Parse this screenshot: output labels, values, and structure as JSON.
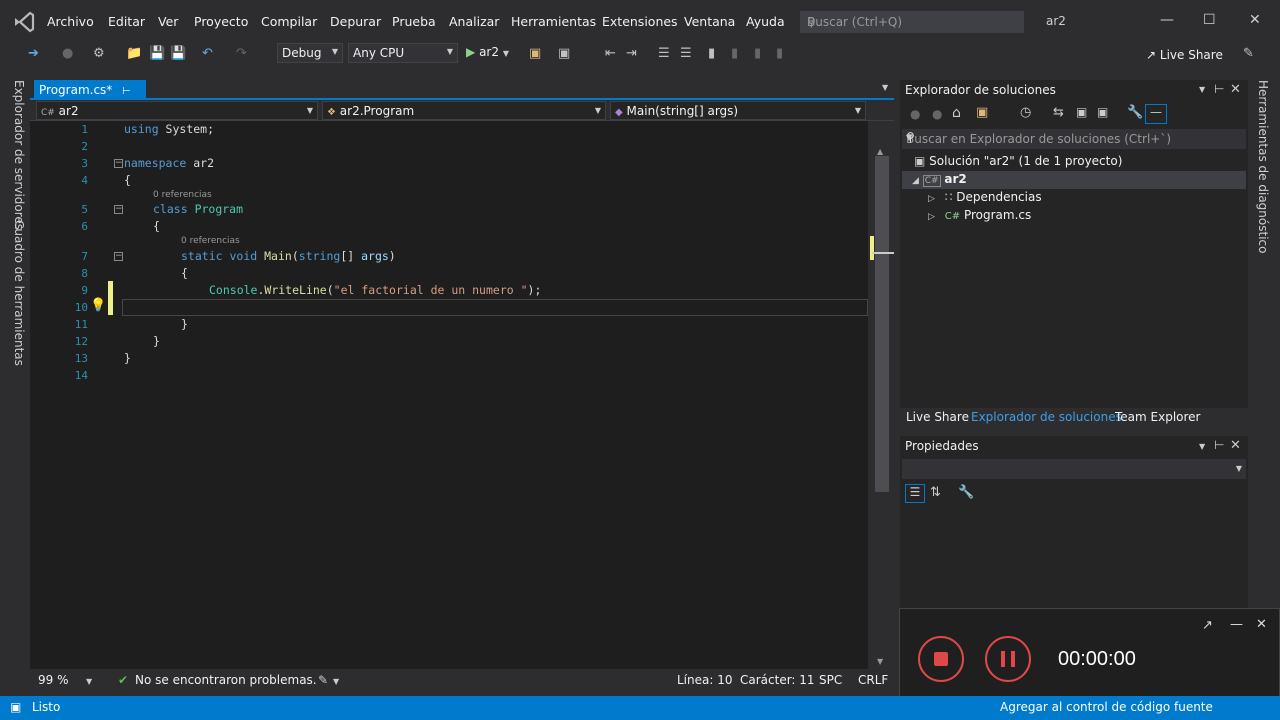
{
  "menu": {
    "items": [
      "Archivo",
      "Editar",
      "Ver",
      "Proyecto",
      "Compilar",
      "Depurar",
      "Prueba",
      "Analizar",
      "Herramientas",
      "Extensiones",
      "Ventana",
      "Ayuda"
    ],
    "search_placeholder": "Buscar (Ctrl+Q)",
    "solution_name": "ar2"
  },
  "toolbar": {
    "config": "Debug",
    "platform": "Any CPU",
    "run_target": "ar2",
    "live_share": "Live Share"
  },
  "left_strip": {
    "server_explorer": "Explorador de servidores",
    "toolbox": "Cuadro de herramientas"
  },
  "right_strip": {
    "diagnostics": "Herramientas de diagnóstico"
  },
  "editor": {
    "tab_label": "Program.cs*",
    "nav_project": "ar2",
    "nav_class": "ar2.Program",
    "nav_member": "Main(string[] args)",
    "line_numbers": [
      "1",
      "2",
      "3",
      "4",
      "5",
      "6",
      "7",
      "8",
      "9",
      "10",
      "11",
      "12",
      "13",
      "14"
    ],
    "refs_label": "0 referencias",
    "code": {
      "l1_kw": "using",
      "l1_rest": " System;",
      "l3_kw": "namespace",
      "l3_rest": " ar2",
      "open_brace": "{",
      "close_brace": "}",
      "l5_kw": "class",
      "l5_type": "Program",
      "l7_kw1": "static",
      "l7_kw2": "void",
      "l7_method": "Main",
      "l7_p1": "(",
      "l7_kw3": "string",
      "l7_p2": "[] ",
      "l7_param": "args",
      "l7_p3": ")",
      "l9_type": "Console",
      "l9_dot": ".",
      "l9_method": "WriteLine",
      "l9_open": "(",
      "l9_str": "\"el factorial de un numero \"",
      "l9_close": ");"
    }
  },
  "editor_status": {
    "zoom": "99 %",
    "problems": "No se encontraron problemas.",
    "line": "Línea: 10",
    "char": "Carácter: 11",
    "indent": "SPC",
    "eol": "CRLF"
  },
  "solution_explorer": {
    "title": "Explorador de soluciones",
    "search_placeholder": "Buscar en Explorador de soluciones (Ctrl+`)",
    "solution": "Solución \"ar2\" (1 de 1 proyecto)",
    "project": "ar2",
    "dependencies": "Dependencias",
    "file": "Program.cs",
    "tabs": [
      "Live Share",
      "Explorador de soluciones",
      "Team Explorer"
    ]
  },
  "properties": {
    "title": "Propiedades"
  },
  "recording": {
    "time": "00:00:00"
  },
  "statusbar": {
    "text": "Listo",
    "right_text": "Agregar al control de código fuente"
  },
  "colors": {
    "accent": "#007acc",
    "record_red": "#e04848"
  }
}
